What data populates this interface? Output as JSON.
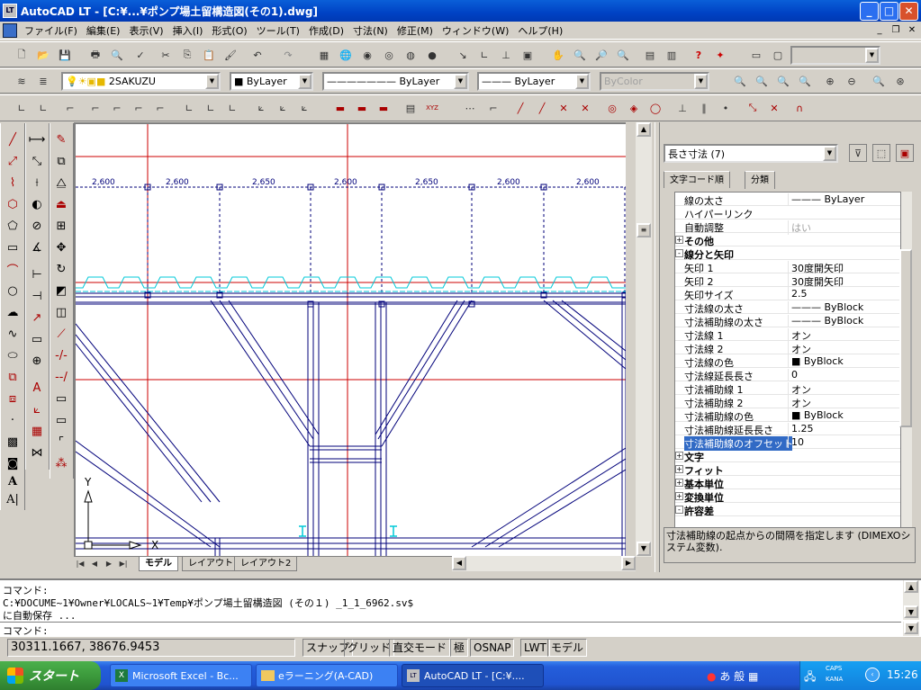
{
  "title": "AutoCAD LT - [C:¥...¥ポンプ場土留構造図(その1).dwg]",
  "menus": [
    "ファイル(F)",
    "編集(E)",
    "表示(V)",
    "挿入(I)",
    "形式(O)",
    "ツール(T)",
    "作成(D)",
    "寸法(N)",
    "修正(M)",
    "ウィンドウ(W)",
    "ヘルプ(H)"
  ],
  "layers_toolbar": {
    "layer": "2SAKUZU",
    "color": "ByLayer",
    "linetype": "ByLayer",
    "lineweight": "ByLayer",
    "plotstyle": "ByColor"
  },
  "dimensions": [
    "2,600",
    "2,600",
    "2,650",
    "2,600",
    "2,650",
    "2,600",
    "2,600"
  ],
  "axis_labels": {
    "y": "Y",
    "x": "X"
  },
  "layout_tabs": [
    "モデル",
    "レイアウト1",
    "レイアウト2"
  ],
  "properties": {
    "selector": "長さ寸法 (7)",
    "tabs": [
      "文字コード順",
      "分類"
    ],
    "rows": [
      {
        "name": "線の太さ",
        "value": "——— ByLayer"
      },
      {
        "name": "ハイパーリンク",
        "value": ""
      },
      {
        "name": "自動調整",
        "value": "はい"
      },
      {
        "name": "その他",
        "value": "",
        "cat": true,
        "exp": "+"
      },
      {
        "name": "線分と矢印",
        "value": "",
        "cat": true,
        "exp": "-"
      },
      {
        "name": "矢印 1",
        "value": "30度開矢印"
      },
      {
        "name": "矢印 2",
        "value": "30度開矢印"
      },
      {
        "name": "矢印サイズ",
        "value": "2.5"
      },
      {
        "name": "寸法線の太さ",
        "value": "——— ByBlock"
      },
      {
        "name": "寸法補助線の太さ",
        "value": "——— ByBlock"
      },
      {
        "name": "寸法線 1",
        "value": "オン"
      },
      {
        "name": "寸法線 2",
        "value": "オン"
      },
      {
        "name": "寸法線の色",
        "value": "■ ByBlock"
      },
      {
        "name": "寸法線延長長さ",
        "value": "0"
      },
      {
        "name": "寸法補助線 1",
        "value": "オン"
      },
      {
        "name": "寸法補助線 2",
        "value": "オン"
      },
      {
        "name": "寸法補助線の色",
        "value": "■ ByBlock"
      },
      {
        "name": "寸法補助線延長長さ",
        "value": "1.25"
      },
      {
        "name": "寸法補助線のオフセット",
        "value": "10",
        "sel": true
      },
      {
        "name": "文字",
        "value": "",
        "cat": true,
        "exp": "+"
      },
      {
        "name": "フィット",
        "value": "",
        "cat": true,
        "exp": "+"
      },
      {
        "name": "基本単位",
        "value": "",
        "cat": true,
        "exp": "+"
      },
      {
        "name": "変換単位",
        "value": "",
        "cat": true,
        "exp": "+"
      },
      {
        "name": "許容差",
        "value": "",
        "cat": true,
        "exp": "-"
      }
    ],
    "description": "寸法補助線の起点からの間隔を指定します (DIMEXOシステム変数)."
  },
  "command": {
    "line1": "コマンド:",
    "line2": "C:¥DOCUME~1¥Owner¥LOCALS~1¥Temp¥ポンプ場土留構造図 (その１) _1_1_6962.sv$",
    "line3": "に自動保存 ...",
    "prompt": "コマンド:"
  },
  "status": {
    "coords": "30311.1667, 38676.9453",
    "toggles": [
      "スナップ",
      "グリッド",
      "直交モード",
      "極",
      "OSNAP",
      "LWT",
      "モデル"
    ]
  },
  "taskbar": {
    "start": "スタート",
    "tasks": [
      "Microsoft Excel - Bc...",
      "eラーニング(A-CAD)",
      "AutoCAD LT - [C:¥...."
    ],
    "ime": "あ 般",
    "caps": "CAPS",
    "kana": "KANA",
    "clock": "15:26"
  },
  "colors": {
    "drawing_red": "#cc0000",
    "drawing_blue": "#00007a",
    "cyan": "#00c8d8"
  }
}
